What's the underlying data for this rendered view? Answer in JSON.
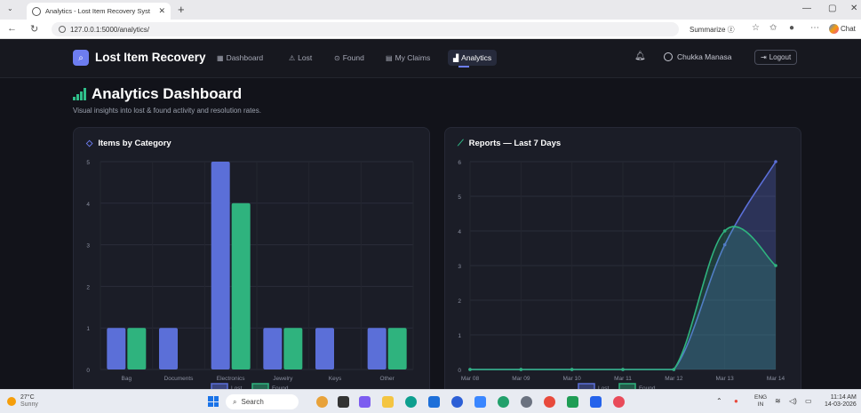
{
  "browser": {
    "tab_title": "Analytics - Lost Item Recovery Syst",
    "url": "127.0.0.1:5000/analytics/",
    "summarize_label": "Summarize",
    "chat_label": "Chat"
  },
  "app": {
    "brand": "Lost Item Recovery",
    "nav": [
      {
        "label": "Dashboard",
        "icon": "grid-icon"
      },
      {
        "label": "Lost",
        "icon": "warning-icon"
      },
      {
        "label": "Found",
        "icon": "check-circle-icon"
      },
      {
        "label": "My Claims",
        "icon": "clipboard-icon"
      },
      {
        "label": "Analytics",
        "icon": "bar-chart-icon",
        "active": true
      }
    ],
    "user_name": "Chukka Manasa",
    "logout_label": "Logout"
  },
  "page": {
    "title": "Analytics Dashboard",
    "subtitle": "Visual insights into lost & found activity and resolution rates."
  },
  "colors": {
    "lost": "#5b6fd8",
    "found": "#2fb37e",
    "background": "#12131a",
    "card": "#1b1d27"
  },
  "chart_data": [
    {
      "type": "bar",
      "title": "Items by Category",
      "categories": [
        "Bag",
        "Documents",
        "Electronics",
        "Jewelry",
        "Keys",
        "Other"
      ],
      "series": [
        {
          "name": "Lost",
          "values": [
            1,
            1,
            5,
            1,
            1,
            1
          ]
        },
        {
          "name": "Found",
          "values": [
            1,
            0,
            4,
            1,
            0,
            1
          ]
        }
      ],
      "ylim": [
        0,
        5
      ],
      "yticks": [
        "0",
        "1",
        "2",
        "3",
        "4",
        "5"
      ],
      "legend": "bottom",
      "grid": true
    },
    {
      "type": "line",
      "title": "Reports — Last 7 Days",
      "x": [
        "Mar 08",
        "Mar 09",
        "Mar 10",
        "Mar 11",
        "Mar 12",
        "Mar 13",
        "Mar 14"
      ],
      "series": [
        {
          "name": "Lost",
          "values": [
            0,
            0,
            0,
            0,
            0,
            3.6,
            6
          ]
        },
        {
          "name": "Found",
          "values": [
            0,
            0,
            0,
            0,
            0,
            4,
            3
          ]
        }
      ],
      "ylim": [
        0,
        6
      ],
      "yticks": [
        "0",
        "1",
        "2",
        "3",
        "4",
        "5",
        "6"
      ],
      "legend": "bottom",
      "grid": true
    }
  ],
  "taskbar": {
    "temperature": "27°C",
    "condition": "Sunny",
    "search_placeholder": "Search",
    "lang_top": "ENG",
    "lang_bottom": "IN",
    "time": "11:14 AM",
    "date": "14-03-2026"
  }
}
